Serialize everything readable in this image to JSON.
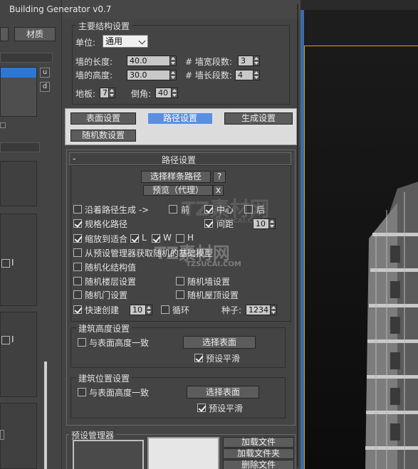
{
  "window": {
    "title": "Building Generator v0.7"
  },
  "left_panel": {
    "material_label": "材质",
    "u_label": "u",
    "d_label": "d",
    "i_label_1": "I",
    "i_label_2": "I"
  },
  "main_settings": {
    "group_title": "主要结构设置",
    "unit_label": "单位:",
    "unit_value": "通用",
    "wall_length_label": "墙的长度:",
    "wall_length_value": "40.0",
    "wall_width_segs_label": "# 墙宽段数:",
    "wall_width_segs_value": "3",
    "wall_height_label": "墙的高度:",
    "wall_height_value": "30.0",
    "wall_length_segs_label": "# 墙长段数:",
    "wall_length_segs_value": "4",
    "floor_label": "地板:",
    "floor_value": "7",
    "chamfer_label": "倒角:",
    "chamfer_value": "40"
  },
  "tabs": {
    "surface": "表面设置",
    "path": "路径设置",
    "generate": "生成设置",
    "random": "随机数设置"
  },
  "path_settings": {
    "rollout_minus": "-",
    "rollout_title": "路径设置",
    "pick_spline": "选择样条路径",
    "help": "?",
    "preview": "预览（代理）",
    "close": "x",
    "along_path": "沿着路径生成 ->",
    "front": "前",
    "center": "中心",
    "back": "后",
    "normalize_path": "规格化路径",
    "spacing": "间距",
    "spacing_value": "10",
    "scale_fit": "缩放到适合",
    "l_label": "L",
    "w_label": "W",
    "h_label": "H",
    "from_preset": "从预设管理器获取随机的基础模型",
    "random_structure": "随机化结构值",
    "random_floor": "随机楼层设置",
    "random_wall": "随机墙设置",
    "random_door": "随机门设置",
    "random_roof": "随机屋顶设置",
    "quick_create": "快速创建",
    "quick_value": "10",
    "loop": "循环",
    "seed_label": "种子:",
    "seed_value": "1234"
  },
  "height_settings": {
    "title": "建筑高度设置",
    "match_surface": "与表面高度一致",
    "pick_surface": "选择表面",
    "preset_smooth": "预设平滑"
  },
  "position_settings": {
    "title": "建筑位置设置",
    "match_surface": "与表面高度一致",
    "pick_surface": "选择表面",
    "preset_smooth": "预设平滑"
  },
  "preset_manager": {
    "title": "预设管理器",
    "load_file": "加载文件",
    "load_folder": "加载文件夹",
    "delete_file": "删除文件"
  },
  "watermark": {
    "text_top": "TZ素材网",
    "sub_top": "TZSUCAI.COM",
    "text_mid": "TZ素材网",
    "sub_mid": "TZSUCAI.COM"
  },
  "colors": {
    "active_tab": "#5b8ee0",
    "selection": "#2b78d6",
    "viewport_border": "#d8a31a"
  }
}
